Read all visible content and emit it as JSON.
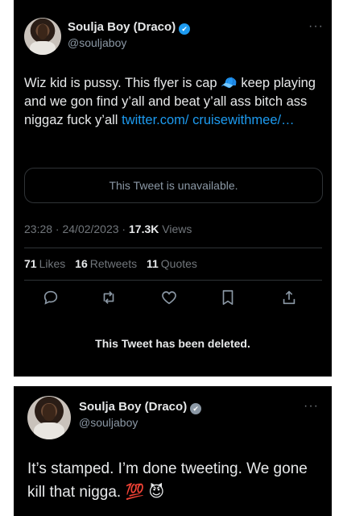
{
  "tweet1": {
    "author": {
      "name": "Soulja Boy (Draco)",
      "handle": "@souljaboy"
    },
    "more": "···",
    "text_main": "Wiz kid is pussy. This flyer is cap 🧢 keep playing and we gon find y’all and beat y’all ass bitch ass niggaz fuck y’all ",
    "link": "twitter.com/ cruisewithmee/…",
    "quoted_unavailable": "This Tweet is unavailable.",
    "meta": {
      "time_date": "23:28 · 24/02/2023 · ",
      "views_count": "17.3K",
      "views_label": " Views"
    },
    "stats": {
      "likes_count": "71",
      "likes_label": "Likes",
      "retweets_count": "16",
      "retweets_label": "Retweets",
      "quotes_count": "11",
      "quotes_label": "Quotes"
    },
    "actions": [
      "reply-icon",
      "retweet-icon",
      "like-icon",
      "bookmark-icon",
      "share-icon"
    ],
    "deleted_notice": "This Tweet has been deleted."
  },
  "tweet2": {
    "author": {
      "name": "Soulja Boy (Draco)",
      "handle": "@souljaboy"
    },
    "more": "···",
    "text": "It’s stamped. I’m done tweeting. We gone kill that nigga. 💯 😈"
  },
  "colors": {
    "background": "#000000",
    "text": "#e7e9ea",
    "muted": "#71767b",
    "link": "#1d9bf0",
    "verified_blue": "#1d9bf0",
    "verified_gray": "#8b98a5"
  }
}
